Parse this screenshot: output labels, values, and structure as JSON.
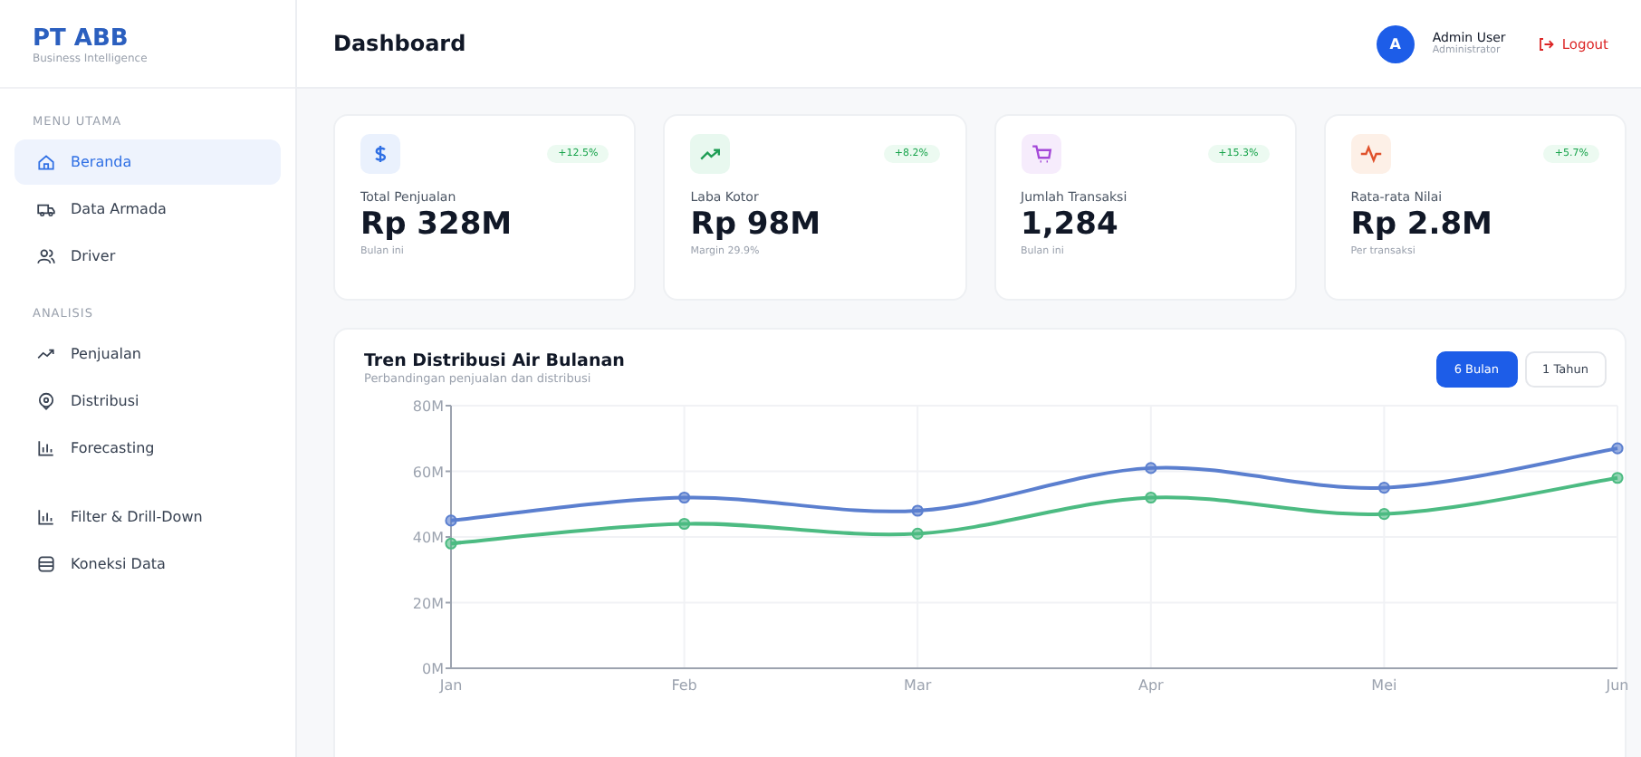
{
  "brand": {
    "title": "PT ABB",
    "subtitle": "Business Intelligence"
  },
  "sidebar": {
    "sections": [
      {
        "heading": "MENU UTAMA",
        "items": [
          {
            "label": "Beranda",
            "kind": "home",
            "selected": true
          },
          {
            "label": "Data Armada",
            "kind": "truck",
            "selected": false
          },
          {
            "label": "Driver",
            "kind": "users",
            "selected": false
          }
        ]
      },
      {
        "heading": "ANALISIS",
        "items": [
          {
            "label": "Penjualan",
            "kind": "trend",
            "selected": false
          },
          {
            "label": "Distribusi",
            "kind": "pin",
            "selected": false
          },
          {
            "label": "Forecasting",
            "kind": "bars",
            "selected": false
          }
        ]
      },
      {
        "items": [
          {
            "label": "Filter & Drill-Down",
            "kind": "bars",
            "selected": false
          },
          {
            "label": "Koneksi Data",
            "kind": "database",
            "selected": false
          }
        ]
      }
    ]
  },
  "header": {
    "title": "Dashboard",
    "user": {
      "initial": "A",
      "name": "Admin User",
      "role": "Administrator"
    },
    "logout": "Logout"
  },
  "cards": [
    {
      "kind": "money",
      "change": "+12.5%",
      "label": "Total Penjualan",
      "value": "Rp 328M",
      "note": "Bulan ini"
    },
    {
      "kind": "trend",
      "change": "+8.2%",
      "label": "Laba Kotor",
      "value": "Rp 98M",
      "note": "Margin 29.9%"
    },
    {
      "kind": "cart",
      "change": "+15.3%",
      "label": "Jumlah Transaksi",
      "value": "1,284",
      "note": "Bulan ini"
    },
    {
      "kind": "pulse",
      "change": "+5.7%",
      "label": "Rata-rata Nilai",
      "value": "Rp 2.8M",
      "note": "Per transaksi"
    }
  ],
  "chart_panel": {
    "title": "Tren Distribusi Air Bulanan",
    "subtitle": "Perbandingan penjualan dan distribusi",
    "ranges": [
      {
        "label": "6 Bulan",
        "selected": true
      },
      {
        "label": "1 Tahun",
        "selected": false
      }
    ],
    "chart_data": {
      "type": "line",
      "grid": true,
      "categories": [
        "Jan",
        "Feb",
        "Mar",
        "Apr",
        "Mei",
        "Jun"
      ],
      "series": [
        {
          "color": "#5b7fcf",
          "marker": "circle",
          "values": [
            45,
            52,
            48,
            61,
            55,
            67
          ]
        },
        {
          "color": "#4cbb82",
          "marker": "circle",
          "values": [
            38,
            44,
            41,
            52,
            47,
            58
          ]
        }
      ],
      "ylim": [
        0,
        80
      ],
      "yticks": [
        {
          "value": 0,
          "label": "0M"
        },
        {
          "value": 20,
          "label": "20M"
        },
        {
          "value": 40,
          "label": "40M"
        },
        {
          "value": 60,
          "label": "60M"
        },
        {
          "value": 80,
          "label": "80M"
        }
      ]
    }
  }
}
